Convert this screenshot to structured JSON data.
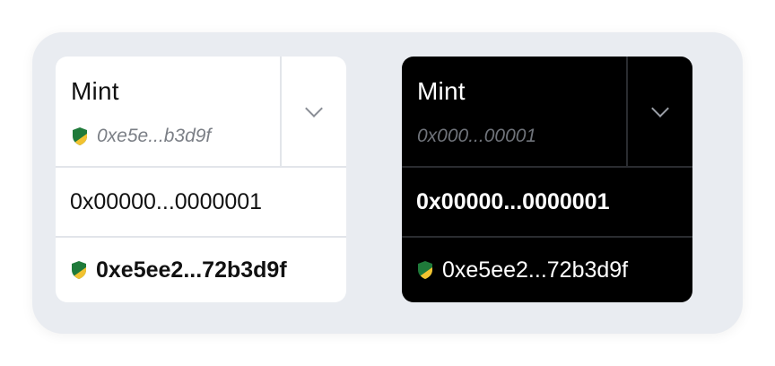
{
  "cards": [
    {
      "theme": "light",
      "title": "Mint",
      "short_address": "0xe5e...b3d9f",
      "short_address_verified": true,
      "token_address": "0x00000...0000001",
      "owner_address": "0xe5ee2...72b3d9f",
      "owner_verified": true
    },
    {
      "theme": "dark",
      "title": "Mint",
      "short_address": "0x000...00001",
      "short_address_verified": false,
      "token_address": "0x00000...0000001",
      "owner_address": "0xe5ee2...72b3d9f",
      "owner_verified": true
    }
  ],
  "icons": {
    "verified": "verified-shield-icon",
    "dropdown": "chevron-down-icon"
  },
  "colors": {
    "shield_green": "#1f7a3a",
    "shield_yellow": "#f2c230",
    "frame_bg": "#e9ecf1"
  }
}
